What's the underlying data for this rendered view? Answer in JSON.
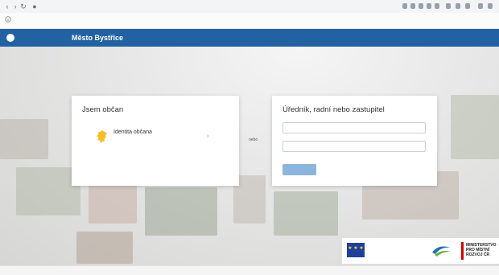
{
  "browser": {
    "icons": [
      "back-arrow-icon",
      "forward-arrow-icon",
      "reload-icon",
      "lock-icon"
    ],
    "url": "",
    "extension_icons": [
      "extension-icon",
      "extension-icon",
      "extension-icon",
      "extension-icon",
      "extension-icon",
      "extension-icon",
      "extension-icon",
      "extension-icon",
      "extension-icon",
      "extension-icon"
    ]
  },
  "notice": {
    "icon": "info-icon",
    "text": "",
    "link": ""
  },
  "header": {
    "logo_text": "",
    "app_name": "Město Bystřice",
    "colors": {
      "bar": "#2362a2"
    }
  },
  "citizen_card": {
    "title": "Jsem občan",
    "login": {
      "icon": "lion-icon",
      "label": "Identita občana",
      "subtitle": "",
      "arrow": "›"
    }
  },
  "or_label": "nebo",
  "official_card": {
    "title": "Úředník, radní nebo zastupitel",
    "username_placeholder": "",
    "password_placeholder": "",
    "button_label": ""
  },
  "partners": {
    "eu_text": "",
    "ministry_text": "MINISTERSTVO PRO MÍSTNÍ ROZVOJ ČR"
  },
  "footer": {
    "copyright": "",
    "links": [
      "",
      "",
      "",
      ""
    ]
  },
  "colors": {
    "accent": "#2362a2",
    "button": "#8db4dd",
    "citizen_icon": "#f2c029"
  }
}
